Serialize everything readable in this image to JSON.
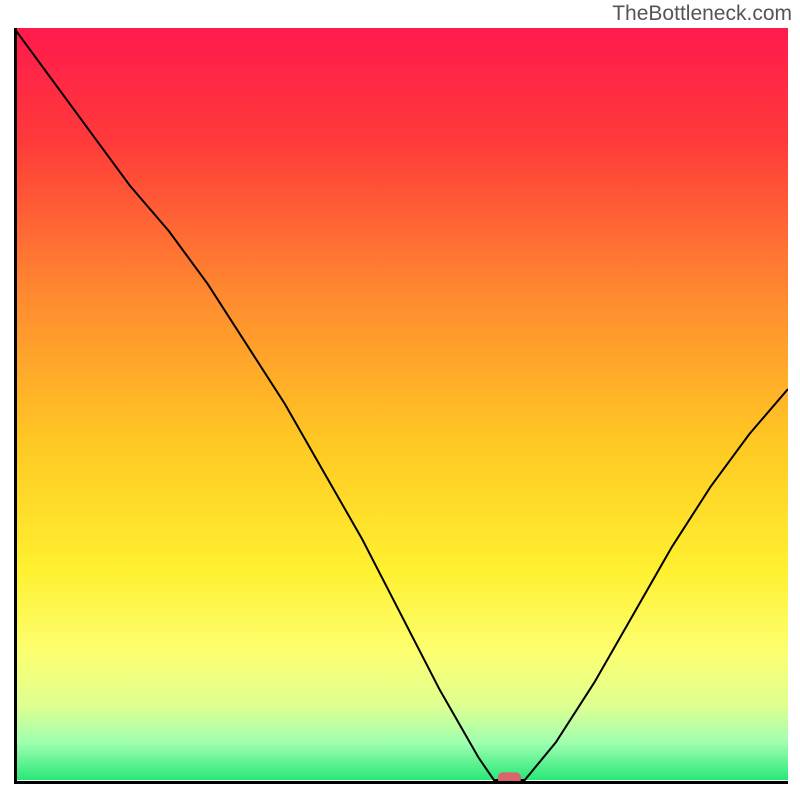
{
  "watermark": "TheBottleneck.com",
  "chart_data": {
    "type": "line",
    "title": "",
    "xlabel": "",
    "ylabel": "",
    "xlim": [
      0,
      100
    ],
    "ylim": [
      0,
      100
    ],
    "x": [
      0,
      5,
      10,
      15,
      20,
      25,
      30,
      35,
      40,
      45,
      50,
      55,
      60,
      62,
      64,
      66,
      70,
      75,
      80,
      85,
      90,
      95,
      100
    ],
    "values": [
      100,
      93,
      86,
      79,
      73,
      66,
      58,
      50,
      41,
      32,
      22,
      12,
      3,
      0,
      0,
      0,
      5,
      13,
      22,
      31,
      39,
      46,
      52
    ],
    "marker_position": {
      "x": 64,
      "y": 0,
      "width": 3,
      "height": 1.5
    },
    "gradient_stops": [
      {
        "offset": 0,
        "color": "#ff1a4d"
      },
      {
        "offset": 0.15,
        "color": "#ff3a3a"
      },
      {
        "offset": 0.35,
        "color": "#ff8830"
      },
      {
        "offset": 0.55,
        "color": "#ffc823"
      },
      {
        "offset": 0.72,
        "color": "#fff030"
      },
      {
        "offset": 0.83,
        "color": "#fcff70"
      },
      {
        "offset": 0.9,
        "color": "#dfff90"
      },
      {
        "offset": 0.95,
        "color": "#a0ffb0"
      },
      {
        "offset": 1.0,
        "color": "#28e878"
      }
    ]
  }
}
